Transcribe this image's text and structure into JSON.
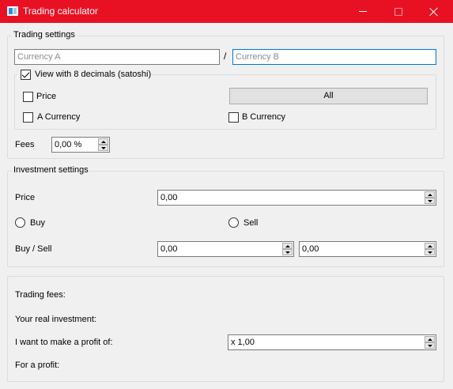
{
  "window": {
    "title": "Trading calculator",
    "titlebar_color": "#e81123",
    "controls": [
      "minimize-icon",
      "maximize-icon",
      "close-icon"
    ]
  },
  "trading_settings": {
    "title": "Trading settings",
    "currency_a": {
      "placeholder": "Currency A",
      "value": ""
    },
    "separator": "/",
    "currency_b": {
      "placeholder": "Currency B",
      "value": ""
    },
    "satoshi": {
      "label": "View with 8 decimals (satoshi)",
      "checked": true
    },
    "price_check": {
      "label": "Price",
      "checked": false
    },
    "all_button": "All",
    "a_currency_check": {
      "label": "A Currency",
      "checked": false
    },
    "b_currency_check": {
      "label": "B Currency",
      "checked": false
    },
    "fees": {
      "label": "Fees",
      "value": "0,00 %"
    }
  },
  "investment_settings": {
    "title": "Investment settings",
    "price": {
      "label": "Price",
      "value": "0,00"
    },
    "buy": {
      "label": "Buy",
      "selected": false
    },
    "sell": {
      "label": "Sell",
      "selected": false
    },
    "buy_sell": {
      "label": "Buy / Sell",
      "value1": "0,00",
      "value2": "0,00"
    }
  },
  "results": {
    "trading_fees": "Trading fees:",
    "real_investment": "Your real investment:",
    "profit_goal": {
      "label": "I want to make a profit of:",
      "value": "x 1,00"
    },
    "for_profit": "For a profit:"
  }
}
